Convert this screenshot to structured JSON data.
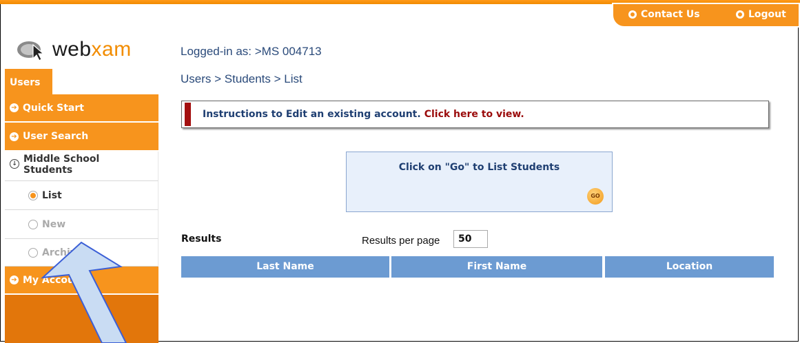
{
  "header": {
    "contact_label": "Contact Us",
    "logout_label": "Logout"
  },
  "logo": {
    "prefix": "web",
    "suffix": "xam"
  },
  "sidebar": {
    "tab_label": "Users",
    "items": [
      {
        "label": "Quick Start"
      },
      {
        "label": "User Search"
      },
      {
        "label": "Middle School Students"
      },
      {
        "label": "List",
        "selected": true
      },
      {
        "label": "New"
      },
      {
        "label": "Archive"
      },
      {
        "label": "My Account"
      }
    ]
  },
  "main": {
    "logged_in": "Logged-in as: >MS 004713",
    "breadcrumb": "Users > Students > List",
    "instructions_text": "Instructions to Edit an existing account.",
    "instructions_link": "Click here to view.",
    "go_box_title": "Click on \"Go\" to List Students",
    "go_button_label": "GO",
    "results_label": "Results",
    "results_per_page_label": "Results per page",
    "results_per_page_value": "50",
    "columns": [
      "Last Name",
      "First Name",
      "Location"
    ]
  },
  "colors": {
    "orange": "#f7941d",
    "dark_orange": "#e2760b",
    "header_blue": "#6c9bd2",
    "navy_text": "#1f3f72",
    "link_red": "#9a0a0a",
    "arrow_fill": "#c9dcf3",
    "arrow_stroke": "#3b5fd6"
  }
}
